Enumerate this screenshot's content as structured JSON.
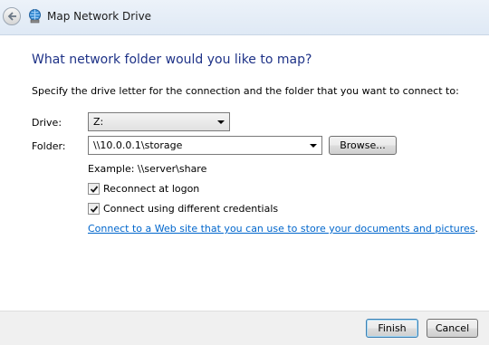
{
  "window": {
    "title": "Map Network Drive",
    "back_icon": "back-arrow-icon",
    "app_icon": "network-drive-globe-icon"
  },
  "main": {
    "heading": "What network folder would you like to map?",
    "instruction": "Specify the drive letter for the connection and the folder that you want to connect to:",
    "drive": {
      "label": "Drive:",
      "value": "Z:"
    },
    "folder": {
      "label": "Folder:",
      "value": "\\\\10.0.0.1\\storage",
      "browse_label": "Browse..."
    },
    "example": "Example: \\\\server\\share",
    "reconnect": {
      "label": "Reconnect at logon",
      "checked": true
    },
    "credentials": {
      "label": "Connect using different credentials",
      "checked": true
    },
    "link": {
      "text": "Connect to a Web site that you can use to store your documents and pictures",
      "suffix": "."
    }
  },
  "footer": {
    "finish_label": "Finish",
    "cancel_label": "Cancel"
  },
  "colors": {
    "heading": "#1e3287",
    "link": "#0066cc",
    "footer_bg": "#f0f0f0"
  }
}
